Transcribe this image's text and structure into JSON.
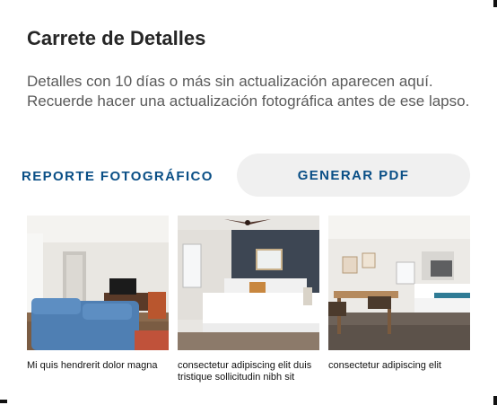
{
  "header": {
    "title": "Carrete de Detalles",
    "description": "Detalles con 10 días o más sin actualización aparecen aquí. Recuerde hacer una actualización fotográfica antes de ese lapso."
  },
  "actions": {
    "photo_report_label": "REPORTE FOTOGRÁFICO",
    "generate_pdf_label": "GENERAR PDF"
  },
  "colors": {
    "accent": "#0a4f86",
    "pill_background": "#f0f0f0"
  },
  "gallery": [
    {
      "caption": "Mi quis hendrerit dolor magna",
      "scene": "living-room"
    },
    {
      "caption": "consectetur adipiscing elit duis tristique sollicitudin nibh sit",
      "scene": "bedroom"
    },
    {
      "caption": "consectetur adipiscing elit",
      "scene": "dining-kitchen"
    }
  ]
}
